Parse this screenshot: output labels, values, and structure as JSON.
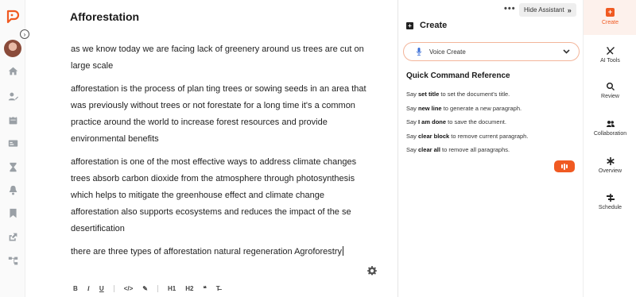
{
  "document": {
    "title": "Afforestation",
    "paragraphs": [
      "as we know today we are facing lack of greenery around us trees are cut on large scale",
      "afforestation is the process of plan ting trees or sowing seeds in an area that was previously without trees or not forestate for a long time it's a common practice around the world to increase forest resources and provide environmental benefits",
      "afforestation is one of the most effective ways to address climate changes trees absorb carbon dioxide from the atmosphere through photosynthesis which helps to mitigate the greenhouse effect and climate change afforestation also supports ecosystems and reduces the impact of the se desertification",
      "there are three types of afforestation natural regeneration Agroforestry"
    ]
  },
  "format_toolbar": {
    "bold": "B",
    "italic": "I",
    "underline": "U",
    "code": "</>",
    "highlight": "✎",
    "h1": "H1",
    "h2": "H2",
    "quote": "❝",
    "clear": "T̶"
  },
  "assistant": {
    "more": "•••",
    "hide_label": "Hide Assistant",
    "hide_chevron": "»",
    "create_title": "Create",
    "voice_create": "Voice Create",
    "quick_ref_title": "Quick Command Reference",
    "commands": [
      {
        "say": "Say ",
        "cmd": "set title",
        "rest": " to set the document's title."
      },
      {
        "say": "Say ",
        "cmd": "new line",
        "rest": " to generate a new paragraph."
      },
      {
        "say": "Say ",
        "cmd": "I am done",
        "rest": " to save the document."
      },
      {
        "say": "Say ",
        "cmd": "clear block",
        "rest": " to remove current paragraph."
      },
      {
        "say": "Say ",
        "cmd": "clear all",
        "rest": " to remove all paragraphs."
      }
    ]
  },
  "tools": [
    {
      "label": "Create",
      "icon": "plus-square-icon",
      "active": true
    },
    {
      "label": "AI Tools",
      "icon": "tools-icon",
      "active": false
    },
    {
      "label": "Review",
      "icon": "magnifier-icon",
      "active": false
    },
    {
      "label": "Collaboration",
      "icon": "users-icon",
      "active": false
    },
    {
      "label": "Overview",
      "icon": "asterisk-icon",
      "active": false
    },
    {
      "label": "Schedule",
      "icon": "schedule-icon",
      "active": false
    }
  ],
  "colors": {
    "accent": "#f05a22",
    "voice_border": "#f3b59a",
    "mic": "#3b6fd8"
  }
}
